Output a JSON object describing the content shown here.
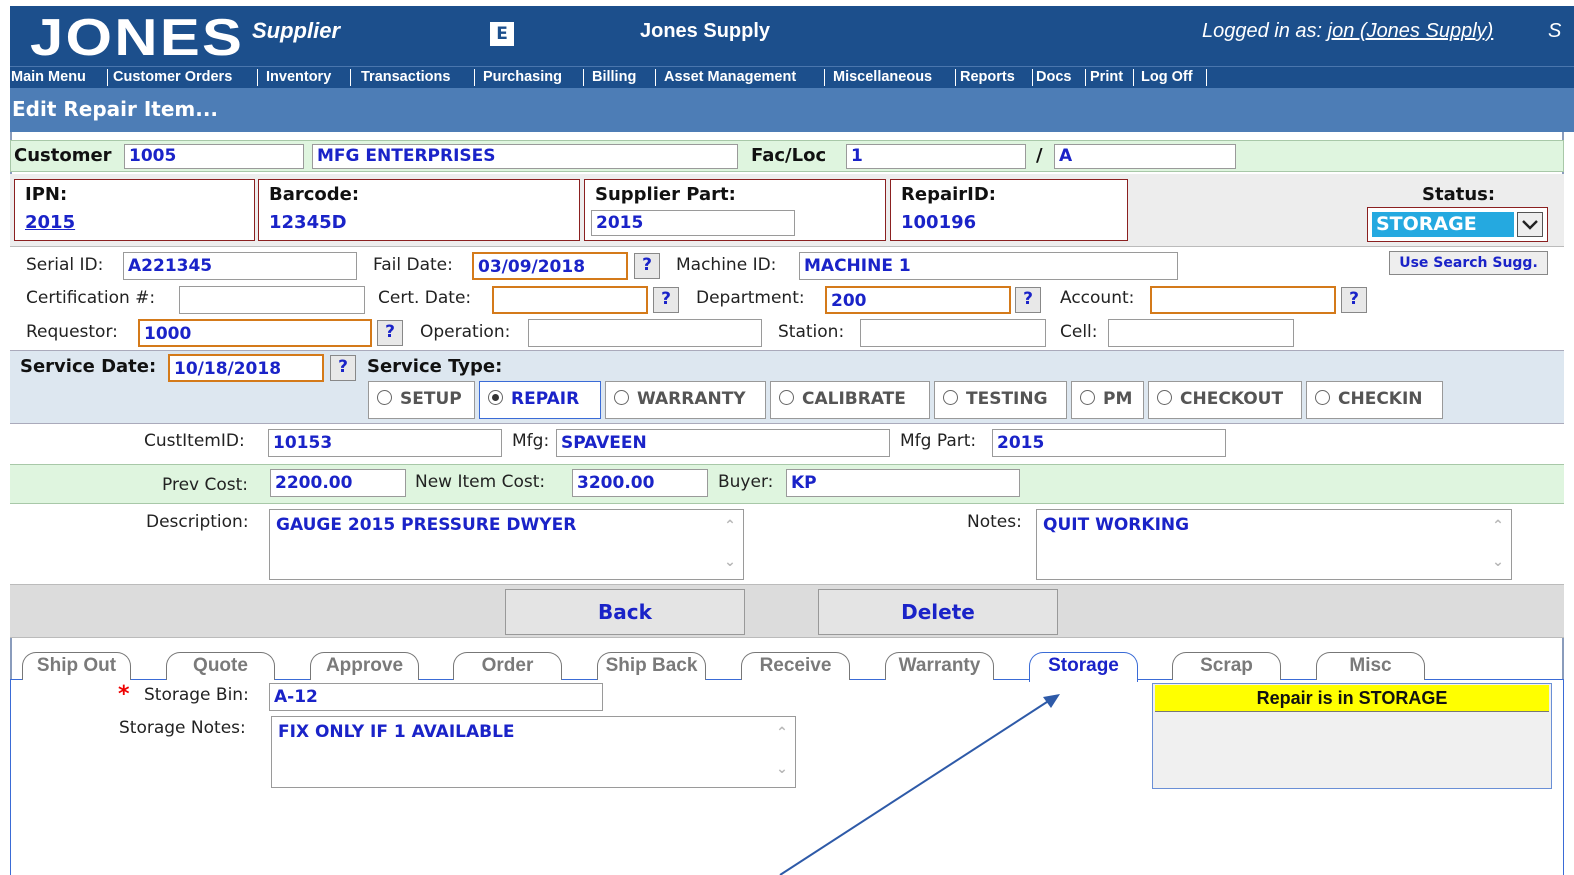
{
  "header": {
    "logo": "JONES",
    "app_role": "Supplier",
    "badge": "E",
    "company": "Jones Supply",
    "logged_prefix": "Logged in as: ",
    "logged_user": "jon (Jones Supply)",
    "trailing": "S"
  },
  "menu": [
    "Main Menu",
    "Customer Orders",
    "Inventory",
    "Transactions",
    "Purchasing",
    "Billing",
    "Asset Management",
    "Miscellaneous",
    "Reports",
    "Docs",
    "Print",
    "Log Off"
  ],
  "page_title": "Edit Repair Item...",
  "customer": {
    "label": "Customer",
    "id": "1005",
    "name": "MFG ENTERPRISES",
    "facloc_label": "Fac/Loc",
    "fac": "1",
    "separator": "/",
    "loc": "A"
  },
  "ident": {
    "ipn_label": "IPN:",
    "ipn": "2015",
    "barcode_label": "Barcode:",
    "barcode": "12345D",
    "supplier_part_label": "Supplier Part:",
    "supplier_part": "2015",
    "repair_id_label": "RepairID:",
    "repair_id": "100196",
    "status_label": "Status:",
    "status": "STORAGE"
  },
  "details": {
    "serial_label": "Serial ID:",
    "serial": "A221345",
    "fail_date_label": "Fail Date:",
    "fail_date": "03/09/2018",
    "machine_label": "Machine ID:",
    "machine": "MACHINE 1",
    "search_button": "Use Search Sugg.",
    "cert_label": "Certification #:",
    "cert": "",
    "cert_date_label": "Cert. Date:",
    "cert_date": "",
    "department_label": "Department:",
    "department": "200",
    "account_label": "Account:",
    "account": "",
    "requestor_label": "Requestor:",
    "requestor": "1000",
    "operation_label": "Operation:",
    "operation": "",
    "station_label": "Station:",
    "station": "",
    "cell_label": "Cell:",
    "cell": "",
    "help_glyph": "?"
  },
  "service": {
    "date_label": "Service Date:",
    "date": "10/18/2018",
    "type_label": "Service Type:",
    "types": [
      "SETUP",
      "REPAIR",
      "WARRANTY",
      "CALIBRATE",
      "TESTING",
      "PM",
      "CHECKOUT",
      "CHECKIN"
    ],
    "selected": "REPAIR"
  },
  "item": {
    "cust_item_label": "CustItemID:",
    "cust_item": "10153",
    "mfg_label": "Mfg:",
    "mfg": "SPAVEEN",
    "mfg_part_label": "Mfg Part:",
    "mfg_part": "2015"
  },
  "costs": {
    "prev_label": "Prev Cost:",
    "prev": "2200.00",
    "new_label": "New Item Cost:",
    "new": "3200.00",
    "buyer_label": "Buyer:",
    "buyer": "KP"
  },
  "text": {
    "description_label": "Description:",
    "description": "GAUGE 2015 PRESSURE DWYER",
    "notes_label": "Notes:",
    "notes": "QUIT WORKING"
  },
  "actions": {
    "back": "Back",
    "delete": "Delete"
  },
  "tabs": [
    "Ship Out",
    "Quote",
    "Approve",
    "Order",
    "Ship Back",
    "Receive",
    "Warranty",
    "Storage",
    "Scrap",
    "Misc"
  ],
  "active_tab": "Storage",
  "storage": {
    "required_mark": "*",
    "bin_label": "Storage Bin:",
    "bin": "A-12",
    "notes_label": "Storage Notes:",
    "notes": "FIX ONLY IF 1 AVAILABLE",
    "status_banner": "Repair is in STORAGE"
  },
  "colors": {
    "header_blue": "#1c4f8c",
    "title_bar": "#4d7db6",
    "field_text": "#1a23c8",
    "green_band": "#dff5df",
    "status_yellow": "#ffff00",
    "status_cyan": "#25a9e0"
  }
}
